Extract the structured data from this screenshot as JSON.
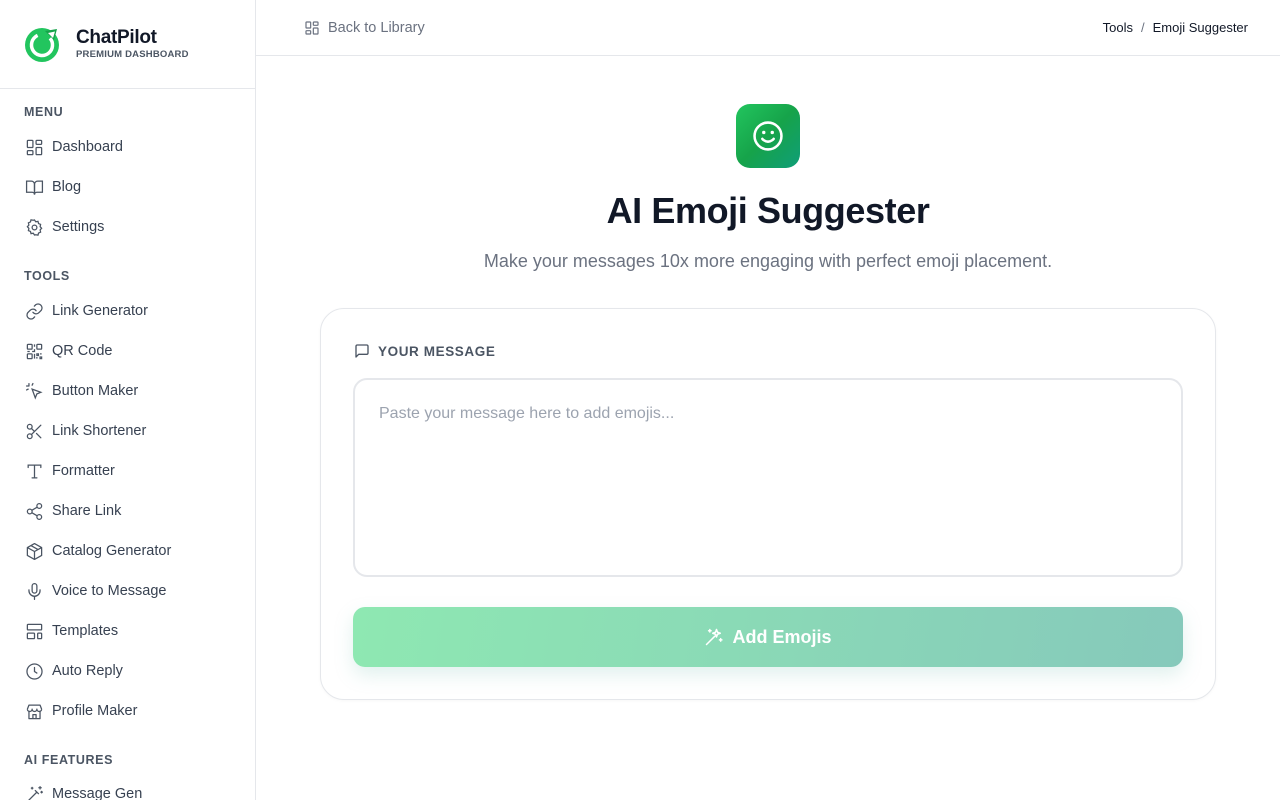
{
  "brand": {
    "name": "ChatPilot",
    "subtitle": "PREMIUM DASHBOARD"
  },
  "sidebar": {
    "sections": [
      {
        "label": "MENU",
        "items": [
          {
            "label": "Dashboard",
            "icon": "grid-icon"
          },
          {
            "label": "Blog",
            "icon": "book-icon"
          },
          {
            "label": "Settings",
            "icon": "gear-icon"
          }
        ]
      },
      {
        "label": "TOOLS",
        "items": [
          {
            "label": "Link Generator",
            "icon": "link-icon"
          },
          {
            "label": "QR Code",
            "icon": "qr-code-icon"
          },
          {
            "label": "Button Maker",
            "icon": "pointer-click-icon"
          },
          {
            "label": "Link Shortener",
            "icon": "scissors-icon"
          },
          {
            "label": "Formatter",
            "icon": "text-type-icon"
          },
          {
            "label": "Share Link",
            "icon": "share-icon"
          },
          {
            "label": "Catalog Generator",
            "icon": "package-icon"
          },
          {
            "label": "Voice to Message",
            "icon": "microphone-icon"
          },
          {
            "label": "Templates",
            "icon": "layout-template-icon"
          },
          {
            "label": "Auto Reply",
            "icon": "clock-icon"
          },
          {
            "label": "Profile Maker",
            "icon": "store-icon"
          }
        ]
      },
      {
        "label": "AI FEATURES",
        "items": [
          {
            "label": "Message Gen",
            "icon": "magic-wand-icon"
          }
        ]
      }
    ]
  },
  "header": {
    "back_label": "Back to Library",
    "breadcrumb": [
      "Tools",
      "Emoji Suggester"
    ],
    "breadcrumb_separator": "/"
  },
  "main": {
    "title": "AI Emoji Suggester",
    "subtitle": "Make your messages 10x more engaging with perfect emoji placement.",
    "field_label": "YOUR MESSAGE",
    "input_value": "",
    "input_placeholder": "Paste your message here to add emojis...",
    "button_label": "Add Emojis"
  },
  "colors": {
    "accent": "#16a34a",
    "button_gradient_start": "#8ee8b2",
    "button_gradient_end": "#86c9bb",
    "text_primary": "#111827",
    "text_muted": "#6b7280",
    "border": "#e5e7eb"
  }
}
